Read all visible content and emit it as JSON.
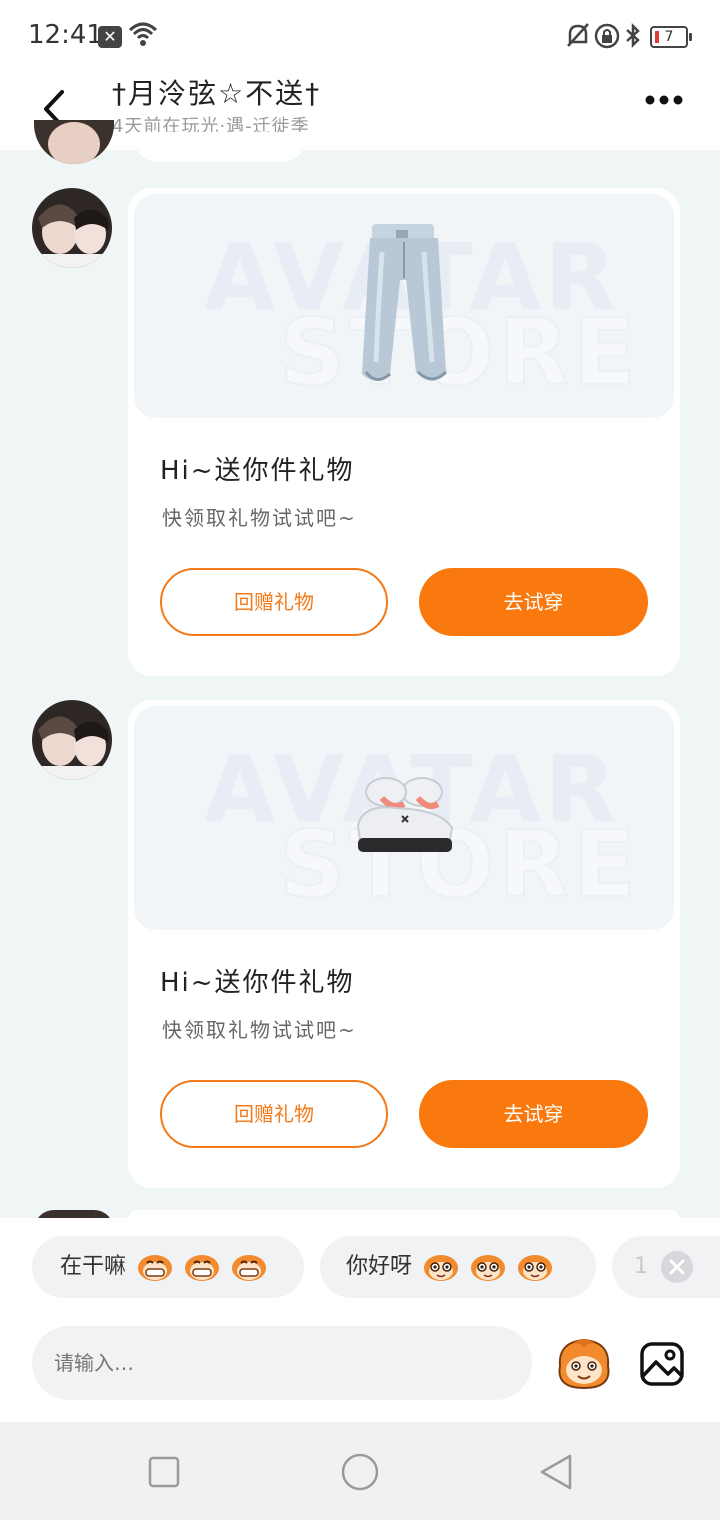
{
  "status": {
    "time": "12:41",
    "battery": "7"
  },
  "header": {
    "title": "†月泠弦☆不送†",
    "subtitle": "4天前在玩光·遇-迁徙季"
  },
  "messages": [
    {
      "card": {
        "watermark_top": "AVATAR",
        "watermark_bottom": "STORE",
        "item_icon": "jeans-icon",
        "title": "Hi~送你件礼物",
        "description": "快领取礼物试试吧~",
        "return_gift_label": "回赠礼物",
        "try_on_label": "去试穿"
      }
    },
    {
      "card": {
        "watermark_top": "AVATAR",
        "watermark_bottom": "STORE",
        "item_icon": "shoes-icon",
        "title": "Hi~送你件礼物",
        "description": "快领取礼物试试吧~",
        "return_gift_label": "回赠礼物",
        "try_on_label": "去试穿"
      }
    }
  ],
  "quick_replies": [
    {
      "text": "在干嘛",
      "emoji": "grinning-mascot-icon"
    },
    {
      "text": "你好呀",
      "emoji": "smiling-mascot-icon"
    },
    {
      "text": "1"
    }
  ],
  "composer": {
    "placeholder": "请输入…"
  },
  "colors": {
    "accent": "#f9790f",
    "background": "#f0f6f6"
  }
}
